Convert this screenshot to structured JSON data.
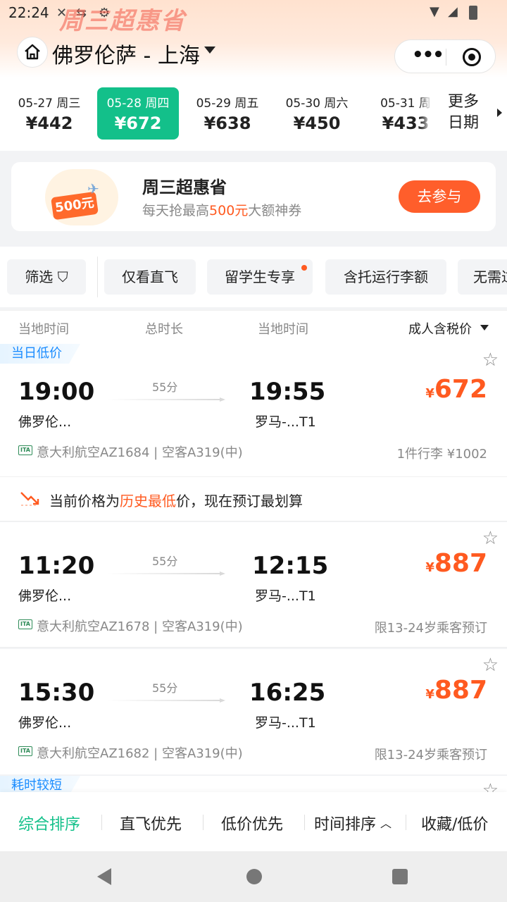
{
  "status": {
    "time": "22:24"
  },
  "header": {
    "promo_banner": "周三超惠省",
    "route": "佛罗伦萨 - 上海",
    "capsule_more": "•••"
  },
  "dates": [
    {
      "date": "05-27 周三",
      "price": "¥442",
      "selected": false
    },
    {
      "date": "05-28 周四",
      "price": "¥672",
      "selected": true
    },
    {
      "date": "05-29 周五",
      "price": "¥638",
      "selected": false
    },
    {
      "date": "05-30 周六",
      "price": "¥450",
      "selected": false
    },
    {
      "date": "05-31 周",
      "price": "¥433",
      "selected": false
    }
  ],
  "more_dates": "更多日期",
  "promo": {
    "badge": "500元",
    "title": "周三超惠省",
    "sub_prefix": "每天抢最高",
    "sub_highlight": "500元",
    "sub_suffix": "大额神券",
    "button": "去参与"
  },
  "filters": [
    {
      "label": "筛选 ⛉"
    },
    {
      "label": "仅看直飞"
    },
    {
      "label": "留学生专享"
    },
    {
      "label": "含托运行李额"
    },
    {
      "label": "无需过"
    }
  ],
  "columns": {
    "dep_time": "当地时间",
    "duration": "总时长",
    "arr_time": "当地时间",
    "price_sort": "成人含税价"
  },
  "flights": [
    {
      "tag": "当日低价",
      "dep": "19:00",
      "dep_city": "佛罗伦...",
      "duration": "55分",
      "arr": "19:55",
      "arr_city": "罗马-...T1",
      "price": "672",
      "airline": "意大利航空AZ1684 | 空客A319(中)",
      "extra": "1件行李 ¥1002"
    },
    {
      "tag": "",
      "dep": "11:20",
      "dep_city": "佛罗伦...",
      "duration": "55分",
      "arr": "12:15",
      "arr_city": "罗马-...T1",
      "price": "887",
      "airline": "意大利航空AZ1678 | 空客A319(中)",
      "extra": "限13-24岁乘客预订"
    },
    {
      "tag": "",
      "dep": "15:30",
      "dep_city": "佛罗伦...",
      "duration": "55分",
      "arr": "16:25",
      "arr_city": "罗马-...T1",
      "price": "887",
      "airline": "意大利航空AZ1682 | 空客A319(中)",
      "extra": "限13-24岁乘客预订"
    }
  ],
  "next_tag": "耗时较短",
  "lowest_notice": {
    "prefix": "当前价格为",
    "highlight": "历史最低",
    "suffix": "价，现在预订最划算"
  },
  "currency": "¥",
  "sort": {
    "comprehensive": "综合排序",
    "direct": "直飞优先",
    "low_price": "低价优先",
    "time": "时间排序",
    "favorite": "收藏/低价"
  },
  "colors": {
    "accent_green": "#13c08a",
    "price_orange": "#ff5a20",
    "tag_blue": "#1a8cff"
  }
}
